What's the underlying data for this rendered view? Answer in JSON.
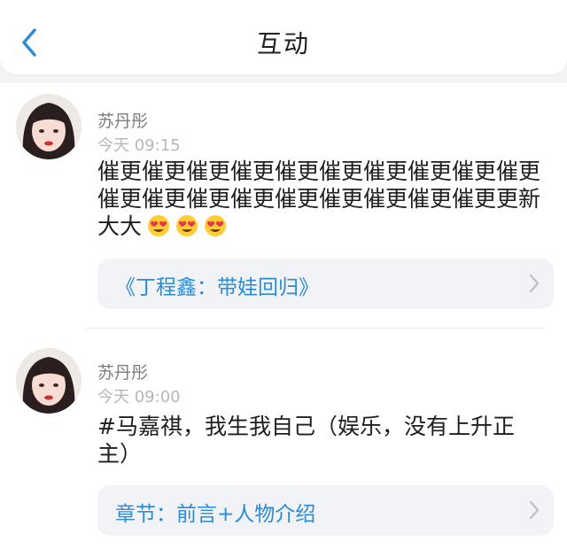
{
  "header": {
    "title": "互动",
    "back_icon": "chevron-left-icon"
  },
  "colors": {
    "accent": "#2a8bd8",
    "link_card_bg": "#f2f3f6"
  },
  "items": [
    {
      "author": "苏丹彤",
      "time": "今天 09:15",
      "text": "催更催更催更催更催更催更催更催更催更催更催更催更催更催更催更催更催更催更催更更新大大",
      "emoji": [
        "heart-eyes-emoji",
        "heart-eyes-emoji",
        "heart-eyes-emoji"
      ],
      "link": "《丁程鑫：带娃回归》"
    },
    {
      "author": "苏丹彤",
      "time": "今天 09:00",
      "text": "#马嘉祺，我生我自己（娱乐，没有上升正主）",
      "link": "章节：前言+人物介绍"
    }
  ]
}
